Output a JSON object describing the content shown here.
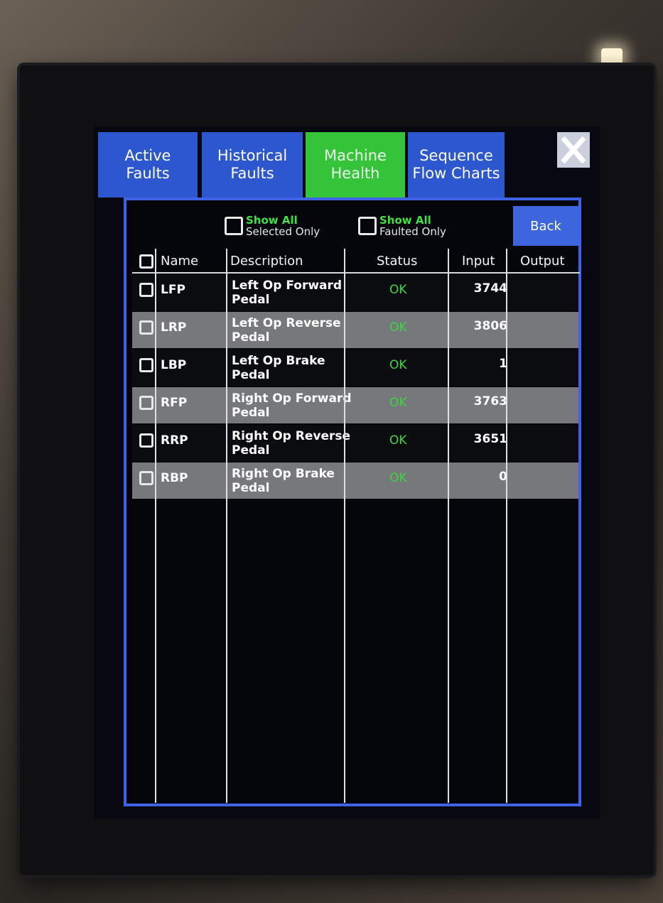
{
  "tabs": [
    {
      "line1": "Active",
      "line2": "Faults"
    },
    {
      "line1": "Historical",
      "line2": "Faults"
    },
    {
      "line1": "Machine",
      "line2": "Health"
    },
    {
      "line1": "Sequence",
      "line2": "Flow Charts"
    }
  ],
  "filters": {
    "selected": {
      "line1": "Show All",
      "line2": "Selected Only"
    },
    "faulted": {
      "line1": "Show All",
      "line2": "Faulted Only"
    }
  },
  "back_label": "Back",
  "columns": {
    "name": "Name",
    "description": "Description",
    "status": "Status",
    "input": "Input",
    "output": "Output"
  },
  "rows": [
    {
      "name": "LFP",
      "desc1": "Left Op Forward",
      "desc2": "Pedal",
      "status": "OK",
      "input": "3744",
      "output": ""
    },
    {
      "name": "LRP",
      "desc1": "Left Op Reverse",
      "desc2": "Pedal",
      "status": "OK",
      "input": "3806",
      "output": ""
    },
    {
      "name": "LBP",
      "desc1": "Left Op Brake",
      "desc2": "Pedal",
      "status": "OK",
      "input": "1",
      "output": ""
    },
    {
      "name": "RFP",
      "desc1": "Right Op Forward",
      "desc2": "Pedal",
      "status": "OK",
      "input": "3763",
      "output": ""
    },
    {
      "name": "RRP",
      "desc1": "Right Op Reverse",
      "desc2": "Pedal",
      "status": "OK",
      "input": "3651",
      "output": ""
    },
    {
      "name": "RBP",
      "desc1": "Right Op Brake",
      "desc2": "Pedal",
      "status": "OK",
      "input": "0",
      "output": ""
    }
  ],
  "colors": {
    "tab": "#2c57cf",
    "tab_active": "#35c33a",
    "status_ok": "#39d83e",
    "panel_border": "#3e63e6"
  }
}
